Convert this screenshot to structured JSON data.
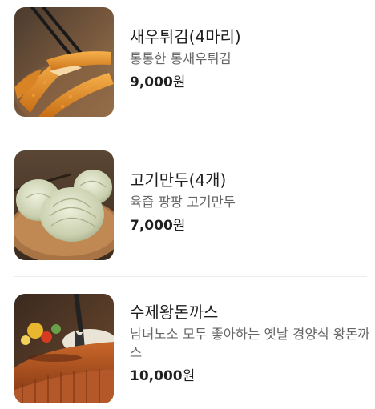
{
  "menu": {
    "items": [
      {
        "name": "새우튀김(4마리)",
        "description": "통통한 통새우튀김",
        "price": "9,000",
        "currency": "원",
        "image_icon": "fried-shrimp-photo"
      },
      {
        "name": "고기만두(4개)",
        "description": "육즙 팡팡 고기만두",
        "price": "7,000",
        "currency": "원",
        "image_icon": "meat-dumpling-photo"
      },
      {
        "name": "수제왕돈까스",
        "description": "남녀노소 모두 좋아하는 옛날 경양식 왕돈까스",
        "price": "10,000",
        "currency": "원",
        "image_icon": "pork-cutlet-photo"
      }
    ]
  }
}
